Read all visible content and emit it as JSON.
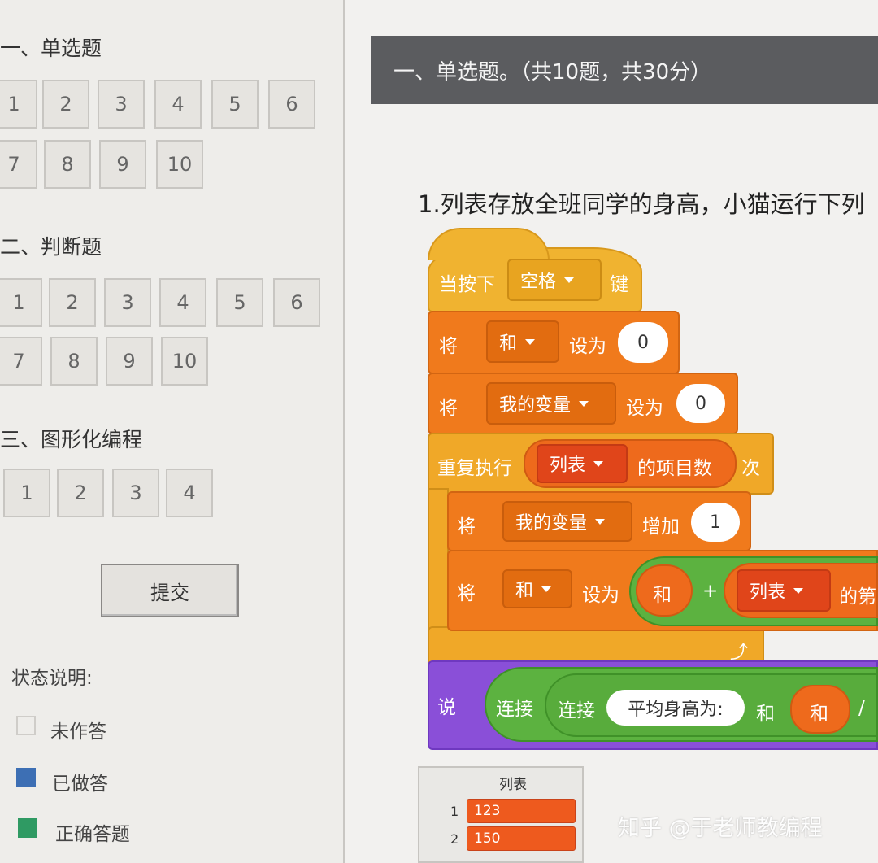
{
  "sidebar": {
    "sections": [
      {
        "title": "一、单选题",
        "buttons": [
          "1",
          "2",
          "3",
          "4",
          "5",
          "6",
          "7",
          "8",
          "9",
          "10"
        ]
      },
      {
        "title": "二、判断题",
        "buttons": [
          "1",
          "2",
          "3",
          "4",
          "5",
          "6",
          "7",
          "8",
          "9",
          "10"
        ]
      },
      {
        "title": "三、图形化编程",
        "buttons": [
          "1",
          "2",
          "3",
          "4"
        ]
      }
    ],
    "submit_label": "提交",
    "legend_title": "状态说明:",
    "legend": [
      {
        "label": "未作答",
        "color": "#eeedea"
      },
      {
        "label": "已做答",
        "color": "#3d6fb4"
      },
      {
        "label": "正确答题",
        "color": "#2f9a63"
      }
    ]
  },
  "main": {
    "section_header": "一、单选题。（共10题，共30分）",
    "question_text": "1.列表存放全班同学的身高，小猫运行下列"
  },
  "blocks": {
    "when_key_prefix": "当按下",
    "when_key_value": "空格",
    "when_key_suffix": "键",
    "set1_label": "将",
    "set1_var": "和",
    "set1_to": "设为",
    "set1_value": "0",
    "set2_label": "将",
    "set2_var": "我的变量",
    "set2_to": "设为",
    "set2_value": "0",
    "repeat_label": "重复执行",
    "repeat_list": "列表",
    "repeat_items": "的项目数",
    "repeat_times": "次",
    "change_label": "将",
    "change_var": "我的变量",
    "change_by": "增加",
    "change_value": "1",
    "set3_label": "将",
    "set3_var": "和",
    "set3_to": "设为",
    "set3_left": "和",
    "set3_plus": "+",
    "set3_list": "列表",
    "set3_item": "的第",
    "say_label": "说",
    "join1": "连接",
    "join2": "连接",
    "say_text": "平均身高为:",
    "say_and": "和",
    "say_var": "和",
    "say_div": "/"
  },
  "list_monitor": {
    "title": "列表",
    "rows": [
      {
        "index": "1",
        "value": "123"
      },
      {
        "index": "2",
        "value": "150"
      }
    ]
  },
  "watermark": "知乎 @于老师教编程"
}
